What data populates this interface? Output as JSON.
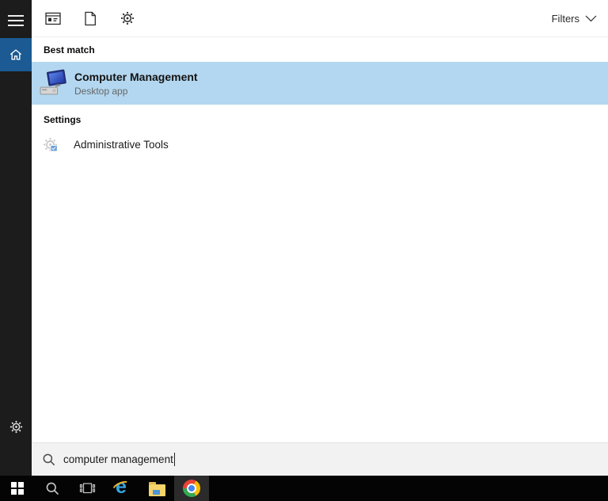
{
  "topbar": {
    "filters_label": "Filters",
    "tabs": [
      {
        "id": "apps",
        "icon": "apps-window-icon"
      },
      {
        "id": "documents",
        "icon": "document-icon"
      },
      {
        "id": "settings",
        "icon": "gear-icon"
      }
    ]
  },
  "sidebar": {
    "items": [
      {
        "id": "menu",
        "icon": "hamburger-icon"
      },
      {
        "id": "home",
        "icon": "home-icon",
        "selected": true
      },
      {
        "id": "settings",
        "icon": "gear-icon"
      }
    ]
  },
  "results": {
    "best_match_header": "Best match",
    "best_match": {
      "title": "Computer Management",
      "subtitle": "Desktop app",
      "icon": "computer-management-icon",
      "selected": true
    },
    "settings_header": "Settings",
    "settings_items": [
      {
        "label": "Administrative Tools",
        "icon": "admin-tools-gear-icon"
      }
    ]
  },
  "search": {
    "value": "computer management",
    "icon": "search-icon"
  },
  "taskbar": {
    "ie_glyph": "e",
    "buttons": [
      {
        "id": "start",
        "icon": "windows-logo-icon"
      },
      {
        "id": "search",
        "icon": "search-icon"
      },
      {
        "id": "task-view",
        "icon": "task-view-icon"
      },
      {
        "id": "internet-explorer",
        "icon": "ie-icon"
      },
      {
        "id": "file-explorer",
        "icon": "folder-icon"
      },
      {
        "id": "chrome",
        "icon": "chrome-icon",
        "active": true
      }
    ]
  },
  "colors": {
    "accent_blue": "#1b5a92",
    "highlight_blue": "#b3d7f0",
    "rail_bg": "#1c1c1c",
    "taskbar_bg": "#040404",
    "search_bg": "#f2f2f2",
    "subtitle_gray": "#666666"
  }
}
